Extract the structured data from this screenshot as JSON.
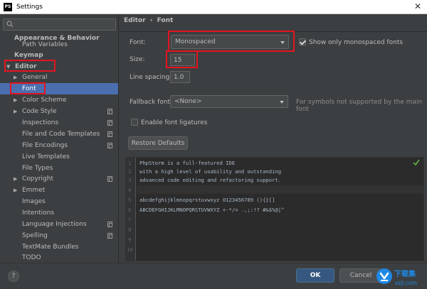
{
  "window": {
    "title": "Settings",
    "app_icon_text": "PS"
  },
  "sidebar": {
    "search_placeholder": "",
    "items": [
      {
        "label": "Appearance & Behavior"
      },
      {
        "label": "Path Variables"
      },
      {
        "label": "Keymap"
      },
      {
        "label": "Editor"
      },
      {
        "label": "General"
      },
      {
        "label": "Font"
      },
      {
        "label": "Color Scheme"
      },
      {
        "label": "Code Style"
      },
      {
        "label": "Inspections"
      },
      {
        "label": "File and Code Templates"
      },
      {
        "label": "File Encodings"
      },
      {
        "label": "Live Templates"
      },
      {
        "label": "File Types"
      },
      {
        "label": "Copyright"
      },
      {
        "label": "Emmet"
      },
      {
        "label": "Images"
      },
      {
        "label": "Intentions"
      },
      {
        "label": "Language Injections"
      },
      {
        "label": "Spelling"
      },
      {
        "label": "TextMate Bundles"
      },
      {
        "label": "TODO"
      }
    ]
  },
  "breadcrumb": {
    "parent": "Editor",
    "separator": "›",
    "current": "Font"
  },
  "font_settings": {
    "font_label": "Font:",
    "font_value": "Monospaced",
    "monospaced_only_label": "Show only monospaced fonts",
    "size_label": "Size:",
    "size_value": "15",
    "line_spacing_label": "Line spacing:",
    "line_spacing_value": "1.0",
    "fallback_label": "Fallback font:",
    "fallback_value": "<None>",
    "fallback_hint": "For symbols not supported by the main font",
    "ligatures_label": "Enable font ligatures",
    "restore_button": "Restore Defaults"
  },
  "preview": {
    "lines": [
      "PhpStorm is a full-featured IDE",
      "with a high level of usability and outstanding",
      "advanced code editing and refactoring support.",
      "",
      "abcdefghijklmnopqrstuvwxyz 0123456789 (){}[]",
      "ABCDEFGHIJKLMNOPQRSTUVWXYZ +-*/= .,;:!? #&$%@|^",
      "",
      "",
      "",
      ""
    ],
    "line_numbers": [
      "1",
      "2",
      "3",
      "4",
      "5",
      "6",
      "7",
      "8",
      "9",
      "10"
    ]
  },
  "footer": {
    "help": "?",
    "ok": "OK",
    "cancel": "Cancel"
  },
  "watermark": {
    "text_cn": "下载集",
    "text_en": "xzji.com"
  },
  "colors": {
    "accent": "#4b6eaf",
    "highlight": "#e3141f",
    "background": "#3c3f41",
    "editor_bg": "#2b2b2b"
  }
}
